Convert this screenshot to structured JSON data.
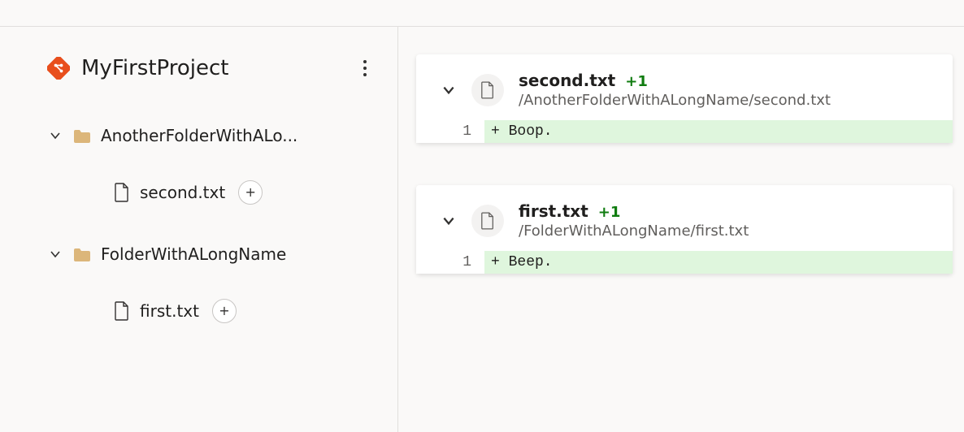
{
  "project": {
    "title": "MyFirstProject"
  },
  "tree": {
    "folders": [
      {
        "name": "AnotherFolderWithALo...",
        "files": [
          {
            "name": "second.txt"
          }
        ]
      },
      {
        "name": "FolderWithALongName",
        "files": [
          {
            "name": "first.txt"
          }
        ]
      }
    ]
  },
  "diffs": [
    {
      "filename": "second.txt",
      "delta": "+1",
      "path": "/AnotherFolderWithALongName/second.txt",
      "line_no": "1",
      "code": "+ Boop."
    },
    {
      "filename": "first.txt",
      "delta": "+1",
      "path": "/FolderWithALongName/first.txt",
      "line_no": "1",
      "code": "+ Beep."
    }
  ]
}
